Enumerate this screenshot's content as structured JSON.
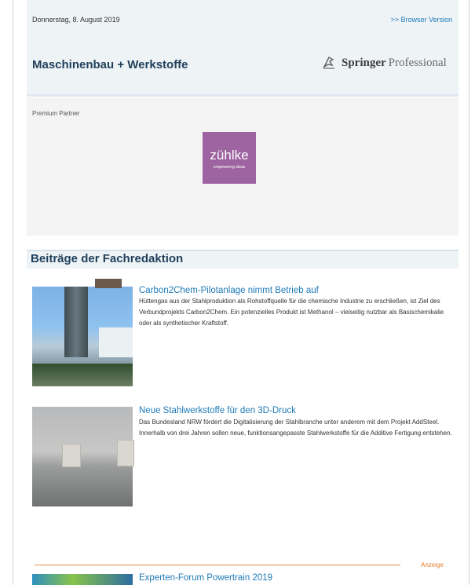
{
  "header": {
    "date": "Donnerstag, 8. August 2019",
    "browser_link": ">> Browser Version",
    "title": "Maschinenbau + Werkstoffe",
    "brand_name": "Springer",
    "brand_sub": "Professional"
  },
  "partner": {
    "label": "Premium Partner",
    "logo_main": "zühlke",
    "logo_sub": "empowering ideas"
  },
  "section": {
    "title": "Beiträge der Fachredaktion"
  },
  "articles": [
    {
      "title": "Carbon2Chem-Pilotanlage nimmt Betrieb auf",
      "body": "Hüttengas aus der Stahlproduktion als Rohstoffquelle für die chemische Industrie zu erschließen, ist Ziel des Verbundprojekts Carbon2Chem. Ein potenzielles Produkt ist Methanol – vielseitig nutzbar als Basischemikalie oder als synthetischer Kraftstoff."
    },
    {
      "title": "Neue Stahlwerkstoffe für den 3D-Druck",
      "body": "Das Bundesland NRW fördert die Digitalisierung der Stahlbranche unter anderem mit dem Projekt AddSteel. Innerhalb von drei Jahren sollen neue, funktionsangepasste Stahlwerkstoffe für die Additive Fertigung entstehen."
    }
  ],
  "ad": {
    "label": "Anzeige",
    "title": "Experten-Forum Powertrain 2019"
  },
  "colors": {
    "link": "#1f7ab8",
    "heading": "#1f3f5a",
    "accent_orange": "#ee8c42",
    "partner_logo": "#9e63a1"
  }
}
